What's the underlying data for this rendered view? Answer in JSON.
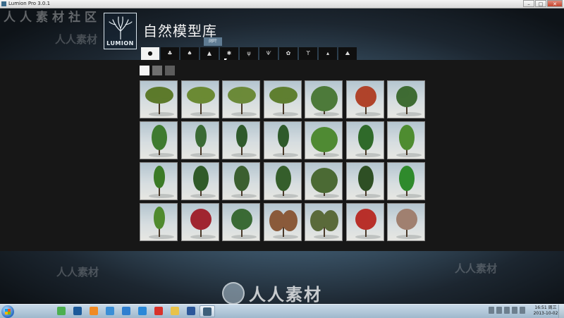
{
  "window": {
    "title": "Lumion Pro 3.0.1",
    "buttons": {
      "minimize": "–",
      "maximize": "□",
      "close": "✕"
    }
  },
  "header": {
    "logo_text": "LUMION",
    "title": "自然模型库",
    "tooltip": "阔叶"
  },
  "tabs": [
    {
      "icon": "seedling-icon",
      "glyph": "●",
      "active": true
    },
    {
      "icon": "deciduous-tree-icon",
      "glyph": "♣",
      "active": false
    },
    {
      "icon": "round-tree-icon",
      "glyph": "♠",
      "active": false
    },
    {
      "icon": "conifer-icon",
      "glyph": "▲",
      "active": false
    },
    {
      "icon": "palm-icon",
      "glyph": "✱",
      "active": false
    },
    {
      "icon": "grass-icon",
      "glyph": "ψ",
      "active": false
    },
    {
      "icon": "plant-icon",
      "glyph": "Ѱ",
      "active": false
    },
    {
      "icon": "flower-icon",
      "glyph": "✿",
      "active": false
    },
    {
      "icon": "cactus-icon",
      "glyph": "ϒ",
      "active": false
    },
    {
      "icon": "rocks-icon",
      "glyph": "▴",
      "active": false
    },
    {
      "icon": "mountain-icon",
      "glyph": "⛰",
      "active": false
    }
  ],
  "swatches": [
    "white",
    "gray",
    "dark-gray"
  ],
  "trees": [
    {
      "shape": "wide",
      "color": "#5d7a2c"
    },
    {
      "shape": "wide",
      "color": "#6b8a34"
    },
    {
      "shape": "wide",
      "color": "#6c8a3a"
    },
    {
      "shape": "wide",
      "color": "#5f7f31"
    },
    {
      "shape": "bush",
      "color": "#4d7a3a"
    },
    {
      "shape": "round",
      "color": "#b0432a"
    },
    {
      "shape": "round",
      "color": "#3f6c33"
    },
    {
      "shape": "tall",
      "color": "#3e7b2f"
    },
    {
      "shape": "slim",
      "color": "#3a6a35"
    },
    {
      "shape": "slim",
      "color": "#2f5a2c"
    },
    {
      "shape": "slim",
      "color": "#2e5a2b"
    },
    {
      "shape": "bush",
      "color": "#4f8a33"
    },
    {
      "shape": "tall",
      "color": "#2f6a2a"
    },
    {
      "shape": "tall",
      "color": "#4e8c30"
    },
    {
      "shape": "slim",
      "color": "#3a7a26"
    },
    {
      "shape": "tall",
      "color": "#2f5a28"
    },
    {
      "shape": "tall",
      "color": "#3b5f30"
    },
    {
      "shape": "tall",
      "color": "#355e2b"
    },
    {
      "shape": "bush",
      "color": "#4b6a34"
    },
    {
      "shape": "tall",
      "color": "#2e4f24"
    },
    {
      "shape": "tall",
      "color": "#2f8a2c"
    },
    {
      "shape": "slim",
      "color": "#4f8a2e"
    },
    {
      "shape": "round",
      "color": "#a02530"
    },
    {
      "shape": "round",
      "color": "#3a6a35"
    },
    {
      "shape": "shrub",
      "color": "#8a5a3a"
    },
    {
      "shape": "shrub",
      "color": "#5a6a3a"
    },
    {
      "shape": "round",
      "color": "#b8302a"
    },
    {
      "shape": "round",
      "color": "#a08070"
    }
  ],
  "watermark": {
    "corner": "人人素材社区",
    "side": "人人素材",
    "bottom": "人人素材"
  },
  "taskbar": {
    "apps": [
      {
        "icon": "app-green-icon",
        "color": "#4caf50"
      },
      {
        "icon": "photoshop-icon",
        "color": "#1c5a9a"
      },
      {
        "icon": "app-orange-icon",
        "color": "#f08a24"
      },
      {
        "icon": "app-bird-icon",
        "color": "#3a8ed6"
      },
      {
        "icon": "app-blue-icon",
        "color": "#2f7fd0"
      },
      {
        "icon": "app-cloud-icon",
        "color": "#2a88d8"
      },
      {
        "icon": "app-red-icon",
        "color": "#d8322a"
      },
      {
        "icon": "folder-icon",
        "color": "#e8c24a"
      },
      {
        "icon": "word-icon",
        "color": "#2b579a"
      },
      {
        "icon": "lumion-icon",
        "color": "#3d5f7a"
      }
    ],
    "time": "16:51 周三",
    "date": "2013-10-02"
  }
}
